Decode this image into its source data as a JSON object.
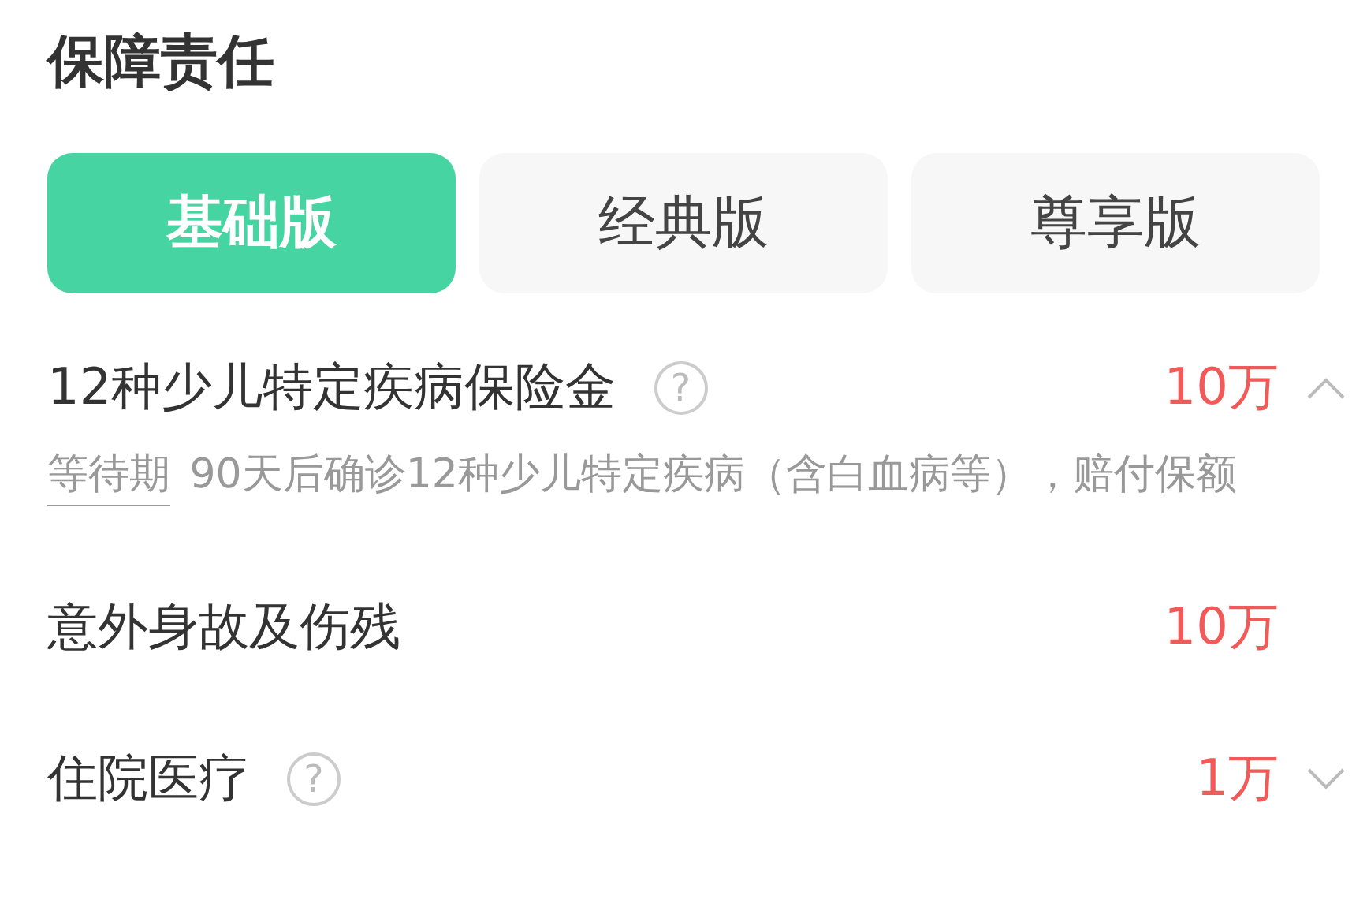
{
  "title": "保障责任",
  "tabs": [
    {
      "label": "基础版",
      "selected": true
    },
    {
      "label": "经典版",
      "selected": false
    },
    {
      "label": "尊享版",
      "selected": false
    }
  ],
  "items": [
    {
      "kind": "expandable",
      "label": "12种少儿特定疾病保险金",
      "help": "?",
      "value": "10万",
      "expanded": true,
      "detail": {
        "term": "等待期",
        "text": " 90天后确诊12种少儿特定疾病（含白血病等），赔付保额"
      }
    },
    {
      "kind": "plain",
      "label": "意外身故及伤残",
      "value": "10万"
    },
    {
      "kind": "expandable",
      "label": "住院医疗",
      "help": "?",
      "value": "1万",
      "expanded": false
    }
  ]
}
